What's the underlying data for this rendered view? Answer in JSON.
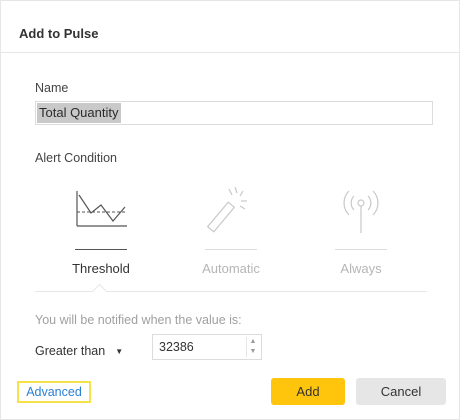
{
  "dialog": {
    "title": "Add to Pulse"
  },
  "name_field": {
    "label": "Name",
    "value": "Total Quantity"
  },
  "alert_condition": {
    "label": "Alert Condition",
    "tabs": [
      {
        "label": "Threshold",
        "icon": "threshold-chart-icon",
        "active": true
      },
      {
        "label": "Automatic",
        "icon": "magic-wand-icon",
        "active": false
      },
      {
        "label": "Always",
        "icon": "antenna-icon",
        "active": false
      }
    ]
  },
  "notify": {
    "text": "You will be notified when the value is:",
    "operator": "Greater than",
    "value": "32386"
  },
  "footer": {
    "advanced_label": "Advanced",
    "add_label": "Add",
    "cancel_label": "Cancel"
  },
  "colors": {
    "primary_button": "#ffc40c",
    "link": "#2a7fd4",
    "highlight_border": "#f5e14a",
    "secondary_button": "#e6e6e6"
  }
}
